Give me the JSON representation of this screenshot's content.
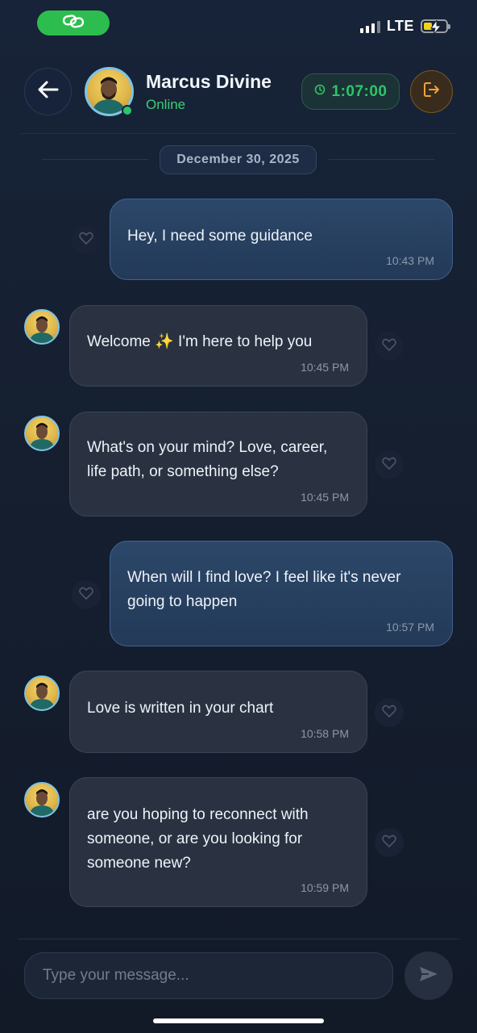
{
  "status_bar": {
    "network": "LTE",
    "link_icon": "link-icon",
    "accent": "#2dbd4e"
  },
  "header": {
    "name": "Marcus Divine",
    "presence": "Online",
    "timer": "1:07:00",
    "back_icon": "arrow-left-icon",
    "exit_icon": "exit-icon",
    "timer_icon": "clock-icon",
    "presence_color": "#3ccf74",
    "exit_color": "#f0a23a"
  },
  "date_divider": "December 30, 2025",
  "messages": [
    {
      "sender": "user",
      "lines": [
        "Hey, I need some guidance"
      ],
      "time": "10:43 PM"
    },
    {
      "sender": "advisor",
      "lines": [
        "Welcome ✨ I'm here to help you"
      ],
      "time": "10:45 PM"
    },
    {
      "sender": "advisor",
      "lines": [
        "What's on your mind? Love, career,",
        "life path, or something else?"
      ],
      "time": "10:45 PM"
    },
    {
      "sender": "user",
      "lines": [
        "When will I find love? I feel like it's never",
        "going to happen"
      ],
      "time": "10:57 PM"
    },
    {
      "sender": "advisor",
      "lines": [
        "Love is written in your chart"
      ],
      "time": "10:58 PM"
    },
    {
      "sender": "advisor",
      "lines": [
        "are you hoping to reconnect with",
        "someone, or are you looking for",
        "someone new?"
      ],
      "time": "10:59 PM"
    }
  ],
  "composer": {
    "placeholder": "Type your message...",
    "send_icon": "send-icon"
  }
}
